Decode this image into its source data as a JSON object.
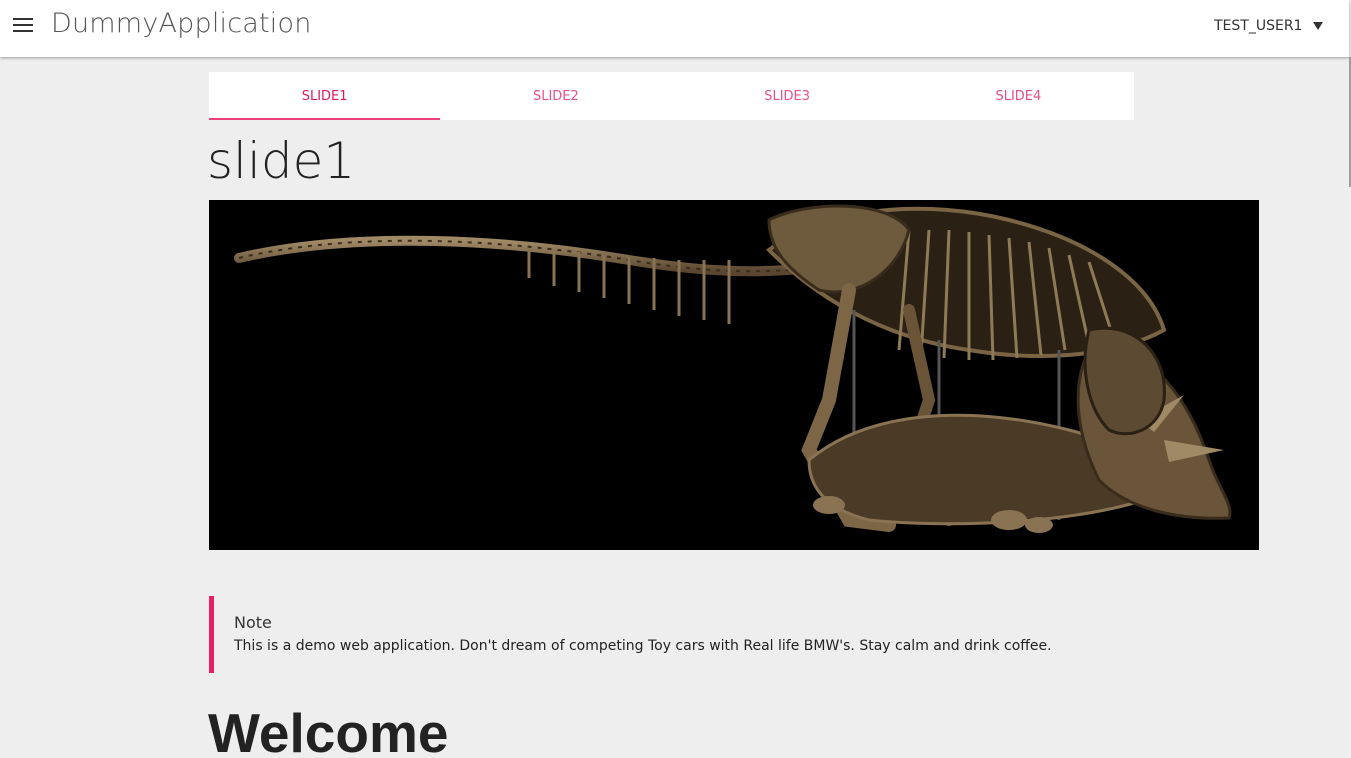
{
  "header": {
    "app_title": "DummyApplication",
    "user_name": "TEST_USER1"
  },
  "tabs": [
    {
      "label": "SLIDE1",
      "active": true
    },
    {
      "label": "SLIDE2",
      "active": false
    },
    {
      "label": "SLIDE3",
      "active": false
    },
    {
      "label": "SLIDE4",
      "active": false
    }
  ],
  "slide": {
    "title": "slide1",
    "image_subject": "dinosaur-skeleton-image"
  },
  "note": {
    "title": "Note",
    "text": "This is a demo web application. Don't dream of competing Toy cars with Real life BMW's. Stay calm and drink coffee."
  },
  "welcome": {
    "heading": "Welcome"
  },
  "colors": {
    "accent": "#e91e63",
    "tab_text": "#e94f8a",
    "header_bg": "#ffffff",
    "page_bg": "#eeeeee"
  }
}
